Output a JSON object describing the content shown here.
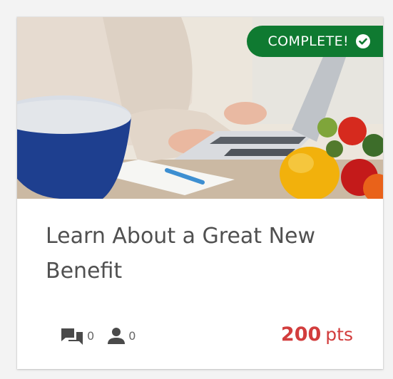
{
  "card": {
    "status_badge": "COMPLETE!",
    "title": "Learn About a Great New Benefit",
    "comments_count": "0",
    "participants_count": "0",
    "points_value": "200",
    "points_unit": "pts"
  },
  "colors": {
    "badge_green": "#0f7a31",
    "points_red": "#d23d3d",
    "title_gray": "#505050"
  },
  "icons": {
    "badge": "check-circle-icon",
    "comments": "chat-bubbles-icon",
    "participants": "person-icon"
  }
}
